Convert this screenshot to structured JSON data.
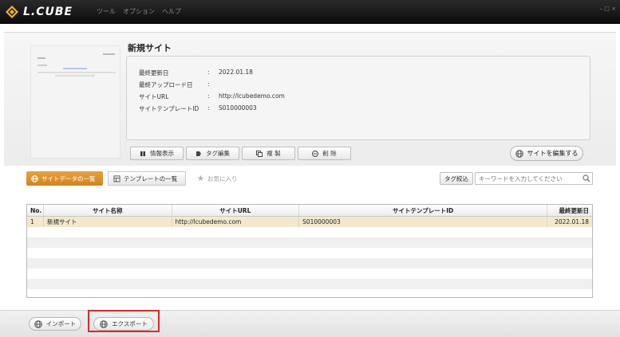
{
  "app": {
    "logo_text": "L.CUBE",
    "brand_color": "#f0b323",
    "window_controls": "– □ ×"
  },
  "menu": {
    "items": [
      "ツール",
      "オプション",
      "ヘルプ"
    ]
  },
  "site": {
    "title": "新規サイト",
    "fields": [
      {
        "label": "最終更新日",
        "sep": ":",
        "value": "2022.01.18"
      },
      {
        "label": "最終アップロード日",
        "sep": ":",
        "value": ""
      },
      {
        "label": "サイトURL",
        "sep": ":",
        "value": "http://lcubedemo.com"
      },
      {
        "label": "サイトテンプレートID",
        "sep": ":",
        "value": "S010000003"
      }
    ]
  },
  "actions": {
    "info": "情報表示",
    "tag_edit": "タグ編集",
    "copy": "複 製",
    "delete": "削 除",
    "edit_site": "サイトを編集する"
  },
  "tabs": {
    "site_list": "サイトデータの一覧",
    "template_list": "テンプレートの一覧",
    "favorites": "お気に入り"
  },
  "search": {
    "tag_filter": "タグ絞込",
    "placeholder": "キーワードを入力してください"
  },
  "table": {
    "headers": [
      "No.",
      "サイト名称",
      "サイトURL",
      "サイトテンプレートID",
      "最終更新日"
    ],
    "rows": [
      [
        "1",
        "新規サイト",
        "http://lcubedemo.com",
        "S010000003",
        "2022.01.18"
      ]
    ]
  },
  "bottom": {
    "import": "インポート",
    "export": "エクスポート"
  },
  "colors": {
    "active_tab": "#dd8e2a",
    "selected_row": "#f4e8cc",
    "highlight": "#e0282a"
  }
}
